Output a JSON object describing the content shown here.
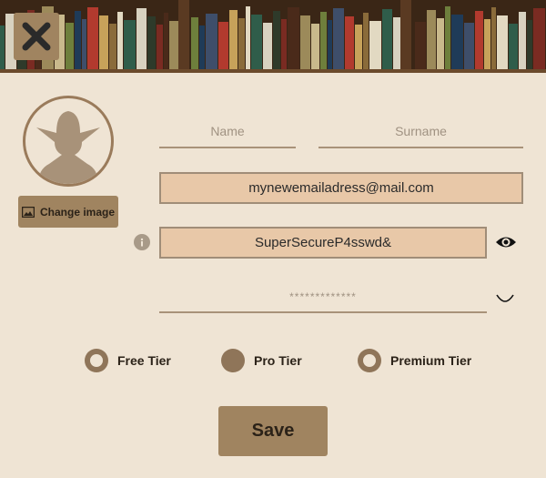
{
  "header": {
    "close_icon": "close-icon"
  },
  "profile": {
    "avatar_icon": "yoda-silhouette-icon",
    "change_image_label": "Change image",
    "change_image_icon": "image-icon"
  },
  "form": {
    "name_placeholder": "Name",
    "surname_placeholder": "Surname",
    "email_value": "mynewemailadress@mail.com",
    "password_value": "SuperSecureP4sswd&",
    "password_info_icon": "info-icon",
    "password_toggle_icon": "eye-icon",
    "confirm_password_placeholder": "*************",
    "confirm_status_icon": "spinner-icon"
  },
  "tiers": [
    {
      "label": "Free Tier",
      "selected": false
    },
    {
      "label": "Pro Tier",
      "selected": true
    },
    {
      "label": "Premium Tier",
      "selected": false
    }
  ],
  "actions": {
    "save_label": "Save"
  },
  "colors": {
    "background": "#efe4d4",
    "accent": "#a08460",
    "field_fill": "#e8c8a8",
    "radio": "#8f7559"
  }
}
